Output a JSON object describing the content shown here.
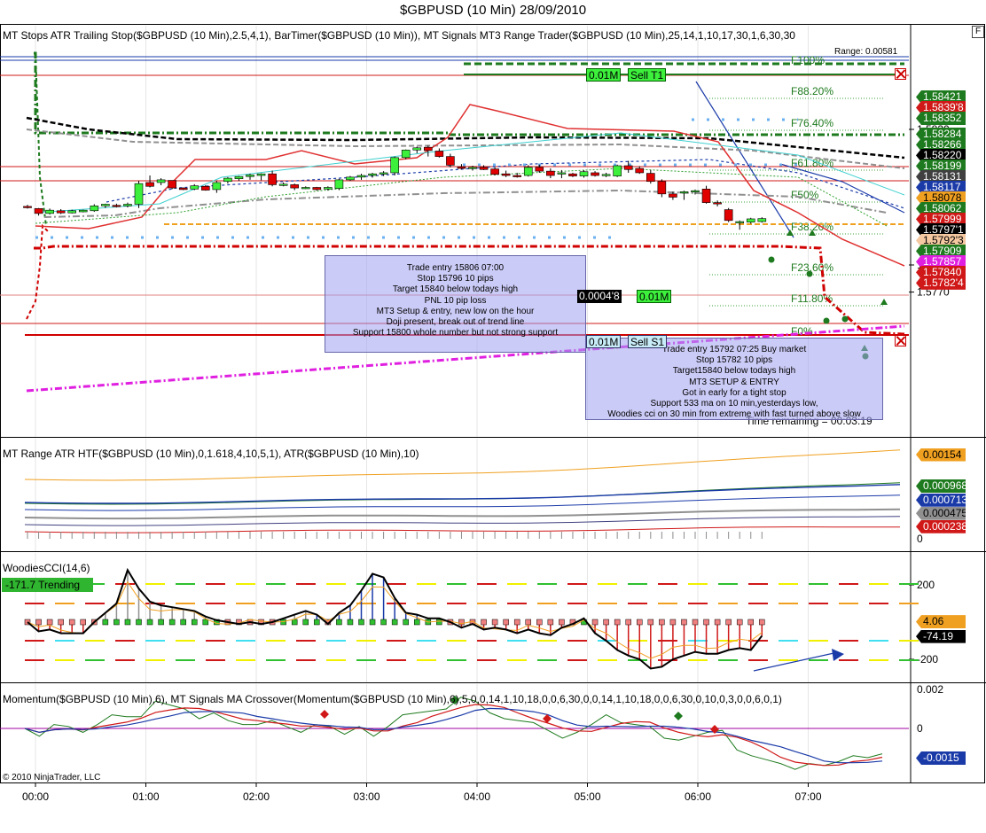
{
  "title": "$GBPUSD (10 Min)  28/09/2010",
  "copyright": "© 2010 NinjaTrader, LLC",
  "close_glyph": "F",
  "panels": {
    "price": {
      "label": "MT Stops ATR Trailing Stop($GBPUSD (10 Min),2.5,4,1),  BarTimer($GBPUSD (10 Min)),  MT Signals MT3 Range Trader($GBPUSD (10 Min),25,14,1,10,17,30,1,6,30,30",
      "range_text": "Range: 0.00581",
      "timer_text": "Time remaining = 00:03:19"
    },
    "atr": {
      "label": "MT Range ATR HTF($GBPUSD (10 Min),0,1.618,4,10,5,1),  ATR($GBPUSD (10 Min),10)"
    },
    "cci": {
      "label": "WoodiesCCI(14,6)",
      "trend_badge": "-171.7 Trending"
    },
    "momentum": {
      "label": "Momentum($GBPUSD (10 Min),6),  MT Signals MA Crossover(Momentum($GBPUSD (10 Min),6),5,0,0,14,1,10,18,0,0,6,30,0,0,14,1,10,18,0,0,6,30,0,10,0,3,0,0,6,0,1)"
    }
  },
  "notes": {
    "left": [
      "Trade entry 15806 07:00",
      "Stop 15796 10 pips",
      "Target 15840 below todays high",
      "PNL 10 pip loss",
      "MT3 Setup & entry, new low on the hour",
      "Doji present, break out of trend line",
      "Support 15800 whole number but not strong support"
    ],
    "right": [
      "Trade entry 15792 07:25 Buy market",
      "Stop 15782 10 pips",
      "Target15840 below todays high",
      "MT3 SETUP & ENTRY",
      "Got in early for a tight stop",
      "Support 533 ma on 10 min,yesterdays low,",
      "Woodies cci on 30 min from extreme with fast turned above slow"
    ]
  },
  "order_tags": {
    "sell_t1": {
      "qty": "0.01M",
      "label": "Sell T1"
    },
    "sell_s1": {
      "qty": "0.01M",
      "label": "Sell S1"
    },
    "position": {
      "pnl": "0.0004'8",
      "qty": "0.01M"
    }
  },
  "fib_labels": [
    "F100%",
    "F88.20%",
    "F76.40%",
    "F61.80%",
    "F50%",
    "F38.20%",
    "F23.60%",
    "F11.80%",
    "F0%"
  ],
  "price_tags": [
    {
      "text": "1.58421",
      "price": 1.58421,
      "bg": "#1e7a1e",
      "fg": "#ffffff"
    },
    {
      "text": "1.5839'8",
      "price": 1.58398,
      "bg": "#d01818",
      "fg": "#ffffff"
    },
    {
      "text": "1.58352",
      "price": 1.58352,
      "bg": "#1e7a1e",
      "fg": "#ffffff"
    },
    {
      "text": "1.58284",
      "price": 1.58284,
      "bg": "#1e7a1e",
      "fg": "#ffffff"
    },
    {
      "text": "1.58266",
      "price": 1.58266,
      "bg": "#1e7a1e",
      "fg": "#ffffff"
    },
    {
      "text": "1.58220",
      "price": 1.5822,
      "bg": "#000000",
      "fg": "#ffffff"
    },
    {
      "text": "1.58199",
      "price": 1.58199,
      "bg": "#1e7a1e",
      "fg": "#ffffff"
    },
    {
      "text": "1.58131",
      "price": 1.58131,
      "bg": "#404040",
      "fg": "#ffffff"
    },
    {
      "text": "1.58117",
      "price": 1.58117,
      "bg": "#1a3aa8",
      "fg": "#ffffff"
    },
    {
      "text": "1.58078",
      "price": 1.58078,
      "bg": "#f0a020",
      "fg": "#000000"
    },
    {
      "text": "1.58062",
      "price": 1.58062,
      "bg": "#1e7a1e",
      "fg": "#ffffff"
    },
    {
      "text": "1.57999",
      "price": 1.57999,
      "bg": "#d01818",
      "fg": "#ffffff"
    },
    {
      "text": "1.5797'1",
      "price": 1.57971,
      "bg": "#000000",
      "fg": "#ffffff"
    },
    {
      "text": "1.5792'3",
      "price": 1.57923,
      "bg": "#f4c8a0",
      "fg": "#000000"
    },
    {
      "text": "1.57909",
      "price": 1.57909,
      "bg": "#1e7a1e",
      "fg": "#ffffff"
    },
    {
      "text": "1.57857",
      "price": 1.57857,
      "bg": "#e020e0",
      "fg": "#ffffff"
    },
    {
      "text": "1.57840",
      "price": 1.5784,
      "bg": "#d01818",
      "fg": "#ffffff"
    },
    {
      "text": "1.5782'4",
      "price": 1.57824,
      "bg": "#d01818",
      "fg": "#ffffff"
    }
  ],
  "atr_tags": [
    {
      "text": "0.00154",
      "value": 0.00154,
      "bg": "#f0a020",
      "fg": "#000000"
    },
    {
      "text": "0.000968",
      "value": 0.000968,
      "bg": "#1e7a1e",
      "fg": "#ffffff"
    },
    {
      "text": "0.000713",
      "value": 0.000713,
      "bg": "#1a3aa8",
      "fg": "#ffffff"
    },
    {
      "text": "0.000475",
      "value": 0.000475,
      "bg": "#909090",
      "fg": "#000000"
    },
    {
      "text": "0.000238",
      "value": 0.000238,
      "bg": "#d01818",
      "fg": "#ffffff"
    }
  ],
  "cci_tags": [
    {
      "text": "4.06",
      "value": 4.06,
      "bg": "#f0a020",
      "fg": "#000000"
    },
    {
      "text": "-74.19",
      "value": -74.19,
      "bg": "#000000",
      "fg": "#ffffff"
    }
  ],
  "momentum_tag": {
    "text": "-0.0015",
    "value": -0.0015,
    "bg": "#1a3aa8",
    "fg": "#ffffff"
  },
  "colors": {
    "bull": "#3cf03c",
    "bear": "#e00000",
    "note_bg": "#a0a0f0",
    "stop_line": "#d00000",
    "fib_line": "#1e7a1e",
    "magenta": "#e020e0"
  },
  "chart_data": {
    "type": "candlestick",
    "title": "$GBPUSD (10 Min)  28/09/2010",
    "x_ticks": [
      "00:00",
      "01:00",
      "02:00",
      "03:00",
      "04:00",
      "05:00",
      "06:00",
      "07:00"
    ],
    "price_y_ticks": [
      "1.5830",
      "1.5780",
      "1.5770"
    ],
    "atr_y_ticks": [
      "0"
    ],
    "cci_y_ticks": [
      "200",
      "-200"
    ],
    "momentum_y_ticks": [
      "0.002",
      "0"
    ],
    "ohlc": [
      [
        1.58016,
        1.58022,
        1.58008,
        1.58014
      ],
      [
        1.58008,
        1.5801,
        1.57982,
        1.5799
      ],
      [
        1.5799,
        1.58008,
        1.57986,
        1.58002
      ],
      [
        1.58,
        1.58006,
        1.57988,
        1.57992
      ],
      [
        1.57992,
        1.58004,
        1.5799,
        1.58
      ],
      [
        1.57996,
        1.58004,
        1.57994,
        1.58002
      ],
      [
        1.58,
        1.58024,
        1.57996,
        1.58018
      ],
      [
        1.58018,
        1.58026,
        1.5801,
        1.58024
      ],
      [
        1.5802,
        1.58026,
        1.58012,
        1.58016
      ],
      [
        1.58018,
        1.5803,
        1.58012,
        1.58024
      ],
      [
        1.58024,
        1.5811,
        1.5801,
        1.581
      ],
      [
        1.58104,
        1.5813,
        1.58086,
        1.5809
      ],
      [
        1.58104,
        1.5812,
        1.58094,
        1.58114
      ],
      [
        1.58112,
        1.58112,
        1.5808,
        1.58084
      ],
      [
        1.58084,
        1.58086,
        1.58076,
        1.58078
      ],
      [
        1.5808,
        1.58098,
        1.58076,
        1.58092
      ],
      [
        1.5809,
        1.58094,
        1.58074,
        1.58076
      ],
      [
        1.58078,
        1.5811,
        1.58066,
        1.58104
      ],
      [
        1.58108,
        1.58124,
        1.581,
        1.5812
      ],
      [
        1.58118,
        1.58128,
        1.5811,
        1.58126
      ],
      [
        1.58126,
        1.58136,
        1.58114,
        1.58132
      ],
      [
        1.5813,
        1.58138,
        1.58112,
        1.58136
      ],
      [
        1.58136,
        1.58148,
        1.5809,
        1.58096
      ],
      [
        1.58096,
        1.58104,
        1.5809,
        1.58098
      ],
      [
        1.58096,
        1.581,
        1.58076,
        1.58084
      ],
      [
        1.58084,
        1.5809,
        1.5808,
        1.58086
      ],
      [
        1.58086,
        1.58088,
        1.58074,
        1.58078
      ],
      [
        1.5808,
        1.5809,
        1.58074,
        1.58086
      ],
      [
        1.58082,
        1.58118,
        1.58076,
        1.58114
      ],
      [
        1.58114,
        1.58128,
        1.5811,
        1.58124
      ],
      [
        1.58124,
        1.58136,
        1.58114,
        1.5813
      ],
      [
        1.5813,
        1.5814,
        1.58122,
        1.58136
      ],
      [
        1.58136,
        1.58146,
        1.58128,
        1.5814
      ],
      [
        1.5814,
        1.582,
        1.5813,
        1.58196
      ],
      [
        1.58196,
        1.58226,
        1.5819,
        1.58224
      ],
      [
        1.58224,
        1.58236,
        1.58212,
        1.58232
      ],
      [
        1.58234,
        1.5824,
        1.582,
        1.58222
      ],
      [
        1.5822,
        1.5823,
        1.58196,
        1.582
      ],
      [
        1.582,
        1.5821,
        1.5816,
        1.58168
      ],
      [
        1.58162,
        1.58172,
        1.58152,
        1.58156
      ],
      [
        1.58156,
        1.58166,
        1.58148,
        1.5816
      ],
      [
        1.5816,
        1.58168,
        1.5815,
        1.58152
      ],
      [
        1.58154,
        1.5816,
        1.5813,
        1.58134
      ],
      [
        1.58136,
        1.58148,
        1.58124,
        1.5813
      ],
      [
        1.5813,
        1.5814,
        1.58122,
        1.58126
      ],
      [
        1.5813,
        1.58168,
        1.58126,
        1.5816
      ],
      [
        1.5816,
        1.5817,
        1.5814,
        1.58146
      ],
      [
        1.58146,
        1.58156,
        1.5812,
        1.5813
      ],
      [
        1.58138,
        1.5815,
        1.5812,
        1.5814
      ],
      [
        1.58136,
        1.5814,
        1.58124,
        1.58128
      ],
      [
        1.58128,
        1.5815,
        1.58122,
        1.58144
      ],
      [
        1.5814,
        1.58146,
        1.58126,
        1.5813
      ],
      [
        1.5813,
        1.5814,
        1.58124,
        1.58134
      ],
      [
        1.58128,
        1.5817,
        1.58124,
        1.58166
      ],
      [
        1.58166,
        1.58184,
        1.5814,
        1.58152
      ],
      [
        1.58156,
        1.58164,
        1.58136,
        1.5814
      ],
      [
        1.58138,
        1.5815,
        1.581,
        1.58108
      ],
      [
        1.58108,
        1.58116,
        1.5805,
        1.58062
      ],
      [
        1.58062,
        1.5807,
        1.5804,
        1.5805
      ],
      [
        1.58068,
        1.58074,
        1.5804,
        1.5807
      ],
      [
        1.58074,
        1.58078,
        1.5806,
        1.58074
      ],
      [
        1.5808,
        1.58092,
        1.58026,
        1.5803
      ],
      [
        1.5803,
        1.58038,
        1.58016,
        1.58026
      ],
      [
        1.58004,
        1.5801,
        1.57958,
        1.57964
      ],
      [
        1.57958,
        1.57964,
        1.5793,
        1.5796
      ],
      [
        1.57958,
        1.57974,
        1.57952,
        1.5797
      ],
      [
        1.5796,
        1.57976,
        1.57956,
        1.57971
      ]
    ]
  }
}
